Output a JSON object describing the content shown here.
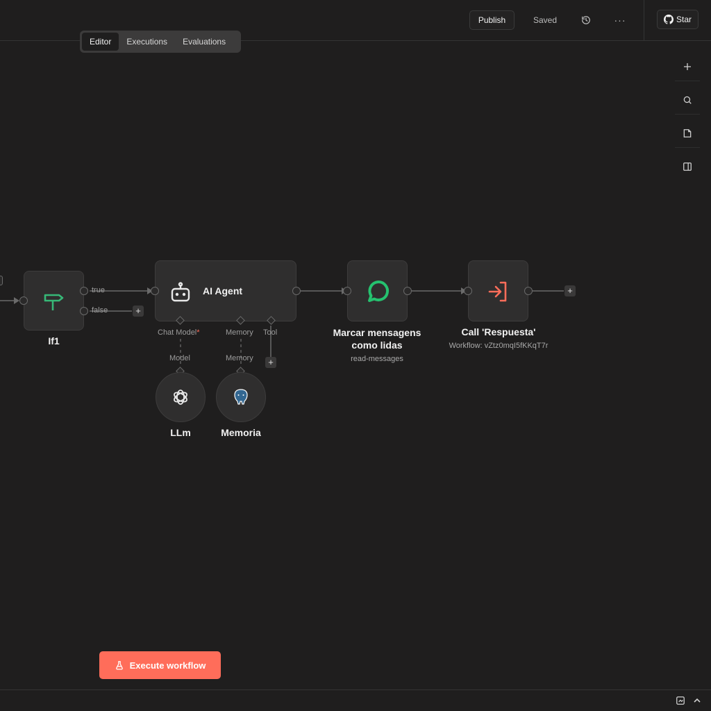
{
  "header": {
    "publish_label": "Publish",
    "saved_label": "Saved",
    "more_label": "···",
    "star_label": "Star"
  },
  "tabs": [
    {
      "label": "Editor",
      "active": true
    },
    {
      "label": "Executions",
      "active": false
    },
    {
      "label": "Evaluations",
      "active": false
    }
  ],
  "side_tools": [
    "plus-icon",
    "search-icon",
    "sticky-note-icon",
    "panel-icon"
  ],
  "nodes": {
    "if": {
      "label": "If1",
      "out_true": "true",
      "out_false": "false"
    },
    "agent": {
      "label": "AI Agent",
      "port_chat_model": "Chat Model",
      "required_mark": "*",
      "port_memory": "Memory",
      "port_tool": "Tool"
    },
    "llm": {
      "label": "LLm",
      "in_label": "Model"
    },
    "memoria": {
      "label": "Memoria",
      "in_label": "Memory"
    },
    "marcar": {
      "label_line1": "Marcar mensagens",
      "label_line2": "como lidas",
      "sublabel": "read-messages"
    },
    "call": {
      "label": "Call 'Respuesta'",
      "sublabel": "Workflow: vZtz0mqI5fKKqT7r"
    }
  },
  "footer": {
    "execute_label": "Execute workflow"
  },
  "colors": {
    "background": "#1f1e1e",
    "accent": "#ff6d5a",
    "if_icon": "#37b877",
    "chat_icon": "#25c16f",
    "call_icon": "#ff6d5a",
    "postgres_icon": "#336791"
  }
}
